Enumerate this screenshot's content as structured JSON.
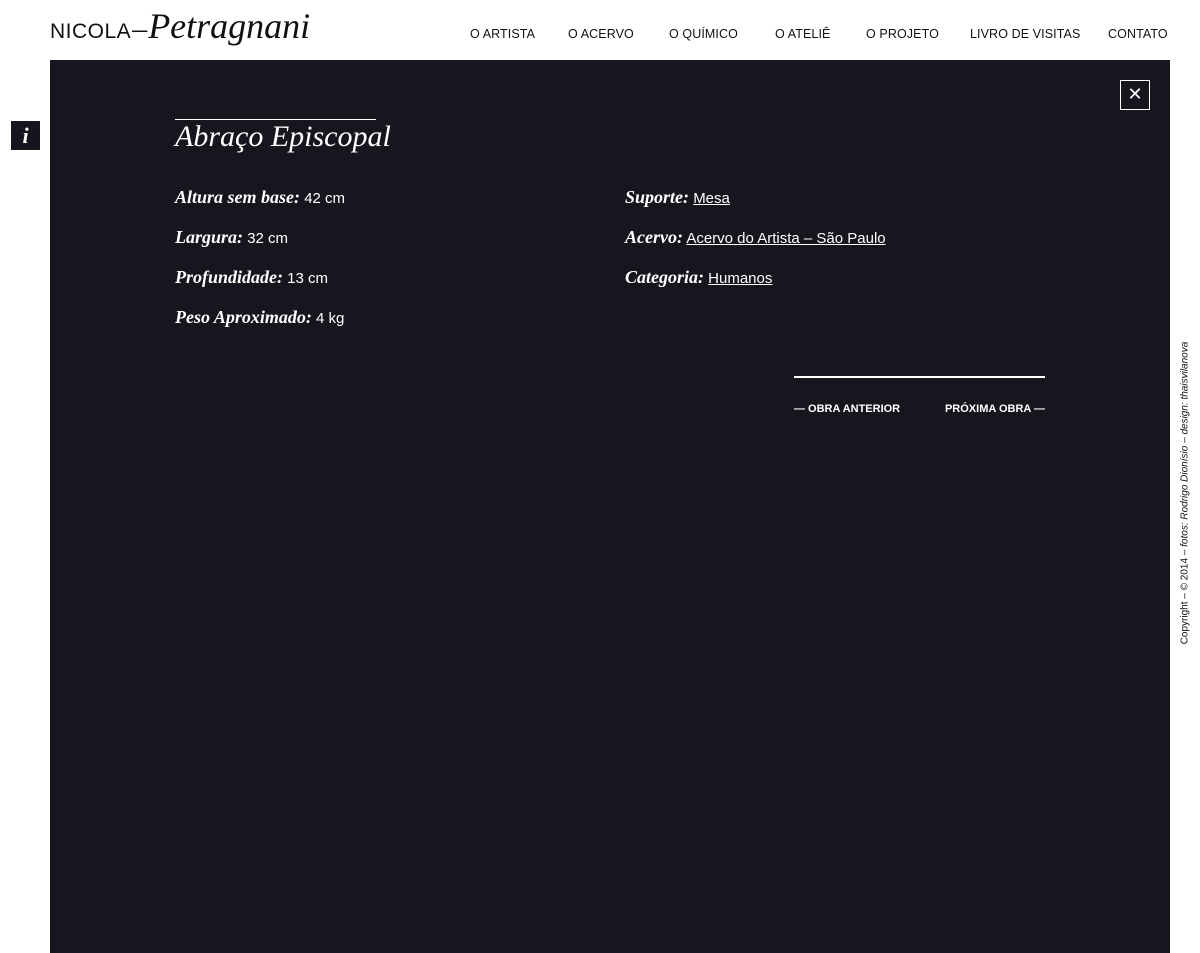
{
  "header": {
    "logo_first": "NICOLA",
    "logo_dash": "–",
    "logo_last": "Petragnani",
    "nav": [
      {
        "label": "O ARTISTA"
      },
      {
        "label": "O ACERVO"
      },
      {
        "label": "O QUÍMICO"
      },
      {
        "label": "O ATELIÊ"
      },
      {
        "label": "O PROJETO"
      },
      {
        "label": "LIVRO DE VISITAS"
      },
      {
        "label": "CONTATO"
      }
    ]
  },
  "info_button": {
    "label": "i"
  },
  "artwork": {
    "close_symbol": "✕",
    "title": "Abraço Episcopal",
    "left_fields": [
      {
        "label": "Altura sem base:",
        "value": "42 cm"
      },
      {
        "label": "Largura:",
        "value": "32 cm"
      },
      {
        "label": "Profundidade:",
        "value": "13 cm"
      },
      {
        "label": "Peso Aproximado:",
        "value": "4 kg"
      }
    ],
    "right_fields": [
      {
        "label": "Suporte:",
        "value": "Mesa"
      },
      {
        "label": "Acervo:",
        "value": "Acervo do Artista – São Paulo"
      },
      {
        "label": "Categoria:",
        "value": "Humanos"
      }
    ],
    "prev_label": "— OBRA ANTERIOR",
    "next_label": "PRÓXIMA OBRA —"
  },
  "footer": {
    "copyright_prefix": "Copyright – © 2014 – ",
    "photos_credit": "fotos: Rodrigo Dionísio",
    "separator": " – ",
    "design_credit": "design: thaisvilanova"
  },
  "colors": {
    "panel_background": "#16161f",
    "text_dark": "#111111",
    "text_light": "#ffffff"
  }
}
